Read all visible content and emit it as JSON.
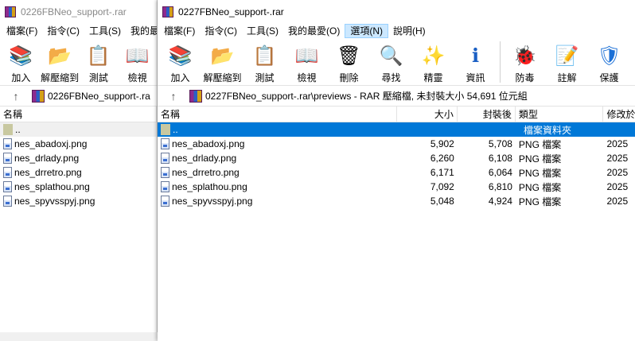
{
  "winA": {
    "title": "0226FBNeo_support-.rar",
    "menu": [
      "檔案(F)",
      "指令(C)",
      "工具(S)",
      "我的最愛"
    ],
    "toolbar": [
      {
        "label": "加入",
        "icon": "add-archive-icon"
      },
      {
        "label": "解壓縮到",
        "icon": "extract-folder-icon"
      },
      {
        "label": "測試",
        "icon": "test-clipboard-icon"
      },
      {
        "label": "檢視",
        "icon": "view-book-icon"
      }
    ],
    "up_glyph": "↑",
    "path": "0226FBNeo_support-.ra",
    "col_name": "名稱",
    "parent": "..",
    "files": [
      "nes_abadoxj.png",
      "nes_drlady.png",
      "nes_drretro.png",
      "nes_splathou.png",
      "nes_spyvsspyj.png"
    ]
  },
  "winB": {
    "title": "0227FBNeo_support-.rar",
    "menu": [
      "檔案(F)",
      "指令(C)",
      "工具(S)",
      "我的最愛(O)",
      "選項(N)",
      "說明(H)"
    ],
    "active_menu": 4,
    "toolbar": [
      {
        "label": "加入",
        "icon": "add-archive-icon",
        "glyph": "📚"
      },
      {
        "label": "解壓縮到",
        "icon": "extract-folder-icon",
        "glyph": "📂"
      },
      {
        "label": "測試",
        "icon": "test-clipboard-icon",
        "glyph": "📋"
      },
      {
        "label": "檢視",
        "icon": "view-book-icon",
        "glyph": "📖"
      },
      {
        "label": "刪除",
        "icon": "trash-icon",
        "glyph": "🗑"
      },
      {
        "label": "尋找",
        "icon": "magnifier-icon",
        "glyph": "🔍"
      },
      {
        "label": "精靈",
        "icon": "wizard-wand-icon",
        "glyph": "✨"
      },
      {
        "label": "資訊",
        "icon": "info-icon",
        "glyph": "ℹ"
      },
      {
        "label": "防毒",
        "icon": "antivirus-bug-icon",
        "glyph": "🐞"
      },
      {
        "label": "註解",
        "icon": "comment-note-icon",
        "glyph": "📝"
      },
      {
        "label": "保護",
        "icon": "shield-icon",
        "glyph": "🛡"
      }
    ],
    "up_glyph": "↑",
    "path": "0227FBNeo_support-.rar\\previews - RAR 壓縮檔, 未封裝大小 54,691 位元組",
    "columns": {
      "name": "名稱",
      "size": "大小",
      "packed": "封裝後",
      "type": "類型",
      "modified": "修改於"
    },
    "parent": {
      "name": "..",
      "type": "檔案資料夾"
    },
    "files": [
      {
        "name": "nes_abadoxj.png",
        "size": "5,902",
        "packed": "5,708",
        "type": "PNG 檔案",
        "modified": "2025"
      },
      {
        "name": "nes_drlady.png",
        "size": "6,260",
        "packed": "6,108",
        "type": "PNG 檔案",
        "modified": "2025"
      },
      {
        "name": "nes_drretro.png",
        "size": "6,171",
        "packed": "6,064",
        "type": "PNG 檔案",
        "modified": "2025"
      },
      {
        "name": "nes_splathou.png",
        "size": "7,092",
        "packed": "6,810",
        "type": "PNG 檔案",
        "modified": "2025"
      },
      {
        "name": "nes_spyvsspyj.png",
        "size": "5,048",
        "packed": "4,924",
        "type": "PNG 檔案",
        "modified": "2025"
      }
    ]
  }
}
